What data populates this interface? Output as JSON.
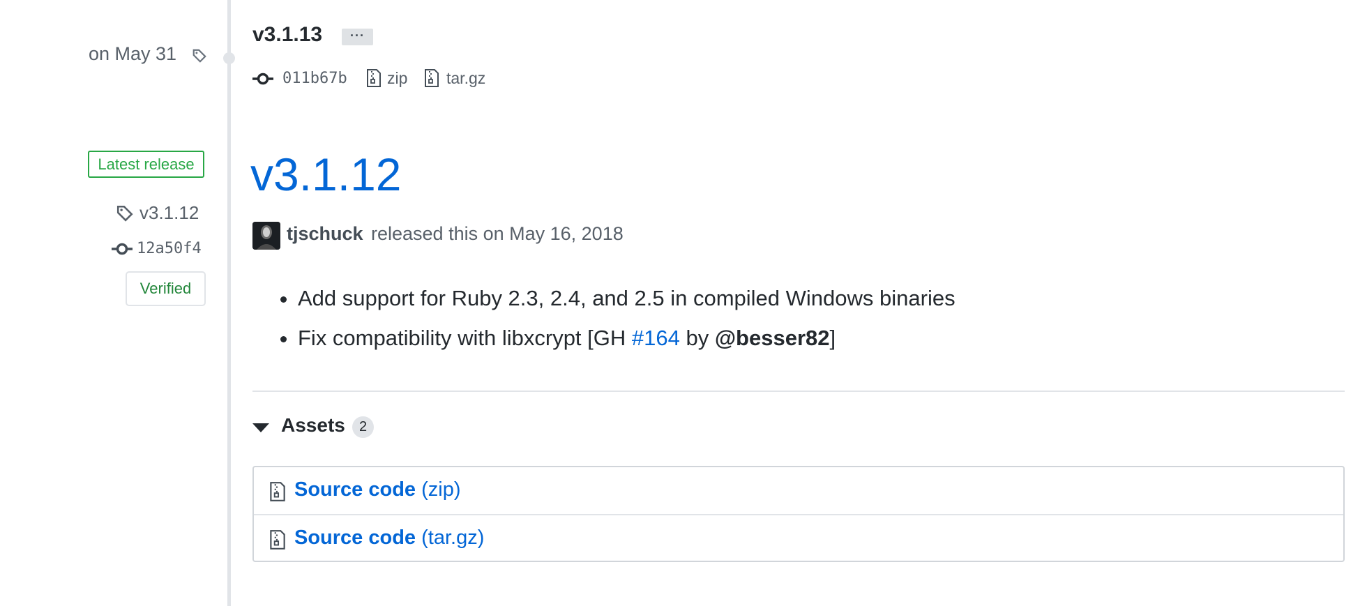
{
  "prev_release": {
    "date": "on May 31",
    "tag": "v3.1.13",
    "more_label": "···",
    "commit": "011b67b",
    "zip_label": "zip",
    "targz_label": "tar.gz"
  },
  "sidebar": {
    "latest_badge": "Latest release",
    "tag": "v3.1.12",
    "commit": "12a50f4",
    "verified": "Verified"
  },
  "release": {
    "title": "v3.1.12",
    "author": "tjschuck",
    "released_text": "released this on May 16, 2018",
    "notes": {
      "item1": "Add support for Ruby 2.3, 2.4, and 2.5 in compiled Windows binaries",
      "item2_prefix": "Fix compatibility with libxcrypt [GH ",
      "item2_issue": "#164",
      "item2_by": " by ",
      "item2_user": "@besser82",
      "item2_suffix": "]"
    },
    "assets": {
      "heading": "Assets",
      "count": "2",
      "items": [
        {
          "name": "Source code",
          "format": "(zip)"
        },
        {
          "name": "Source code",
          "format": "(tar.gz)"
        }
      ]
    }
  },
  "icons": [
    "tag-icon",
    "commit-icon",
    "zip-file-icon",
    "triangle-down-icon",
    "avatar"
  ],
  "colors": {
    "link": "#0366d6",
    "latest_green": "#28a745",
    "verified_green": "#22863a",
    "muted": "#586069",
    "timeline": "#e1e4e8"
  }
}
